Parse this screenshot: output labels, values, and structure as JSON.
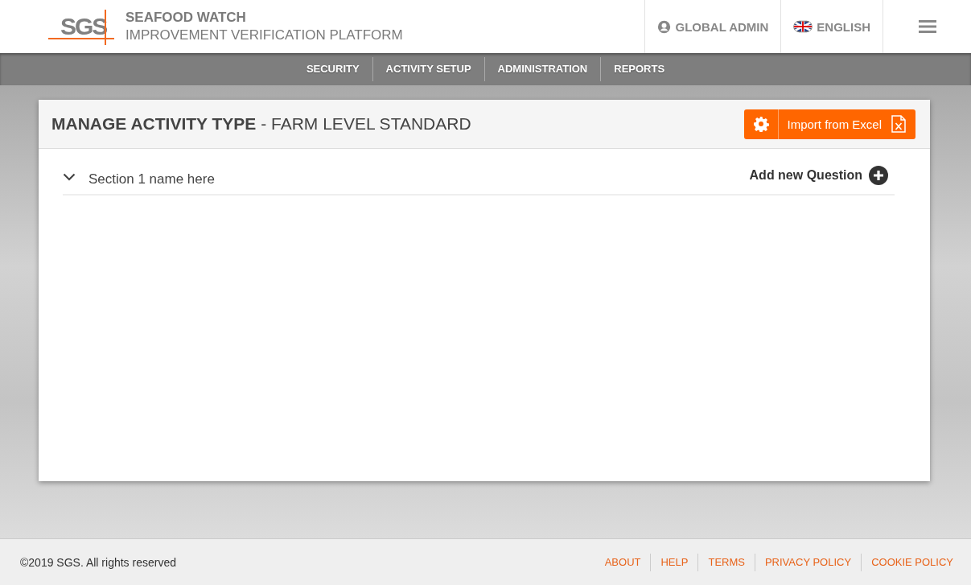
{
  "header": {
    "logo": "SGS",
    "title": "SEAFOOD WATCH",
    "subtitle": "IMPROVEMENT VERIFICATION PLATFORM",
    "user": "GLOBAL ADMIN",
    "language": "ENGLISH"
  },
  "nav": [
    "SECURITY",
    "ACTIVITY SETUP",
    "ADMINISTRATION",
    "REPORTS"
  ],
  "panel": {
    "title": "**MANAGE ACTIVITY TYPE** - FARM LEVEL STANDARD",
    "import_button": "Import from Excel",
    "sections": [
      {
        "name": "Section 1 name here",
        "expanded": true,
        "add_label": "Add new Question"
      }
    ]
  },
  "footer": {
    "copyright": "©2019 SGS. All rights reserved",
    "links": [
      "ABOUT",
      "HELP",
      "TERMS",
      "PRIVACY POLICY",
      "COOKIE POLICY"
    ]
  }
}
